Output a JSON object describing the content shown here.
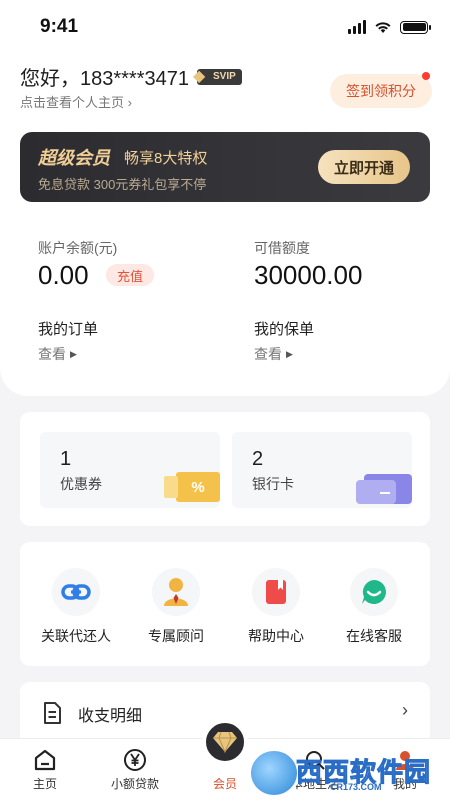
{
  "status_bar": {
    "time": "9:41"
  },
  "header": {
    "greeting": "您好，183****3471",
    "badge": "SVIP",
    "profile_link": "点击查看个人主页 ›",
    "checkin_label": "签到领积分"
  },
  "vip_banner": {
    "title": "超级会员",
    "subtitle": "畅享8大特权",
    "desc": "免息贷款  300元券礼包享不停",
    "cta": "立即开通"
  },
  "account": {
    "balance_label": "账户余额(元)",
    "balance_value": "0.00",
    "recharge": "充值",
    "credit_label": "可借额度",
    "credit_value": "30000.00",
    "orders_title": "我的订单",
    "orders_link": "查看",
    "policies_title": "我的保单",
    "policies_link": "查看"
  },
  "wallet": {
    "coupons_count": "1",
    "coupons_label": "优惠券",
    "coupon_symbol": "%",
    "cards_count": "2",
    "cards_label": "银行卡"
  },
  "services": [
    {
      "label": "关联代还人",
      "icon": "link-icon"
    },
    {
      "label": "专属顾问",
      "icon": "advisor-icon"
    },
    {
      "label": "帮助中心",
      "icon": "book-icon"
    },
    {
      "label": "在线客服",
      "icon": "chat-icon"
    }
  ],
  "list": {
    "statement": "收支明细"
  },
  "tabbar": [
    {
      "label": "主页",
      "icon": "home-icon"
    },
    {
      "label": "小额贷款",
      "icon": "yen-icon"
    },
    {
      "label": "会员",
      "icon": "diamond-icon",
      "active": true
    },
    {
      "label": "本地生活",
      "icon": "search-icon"
    },
    {
      "label": "我的",
      "icon": "user-icon"
    }
  ],
  "watermark": {
    "text": "西西软件园",
    "sub": "CR173.COM"
  },
  "colors": {
    "accent": "#d9502b",
    "gold": "#f0cf97",
    "dark": "#2c2c30"
  }
}
